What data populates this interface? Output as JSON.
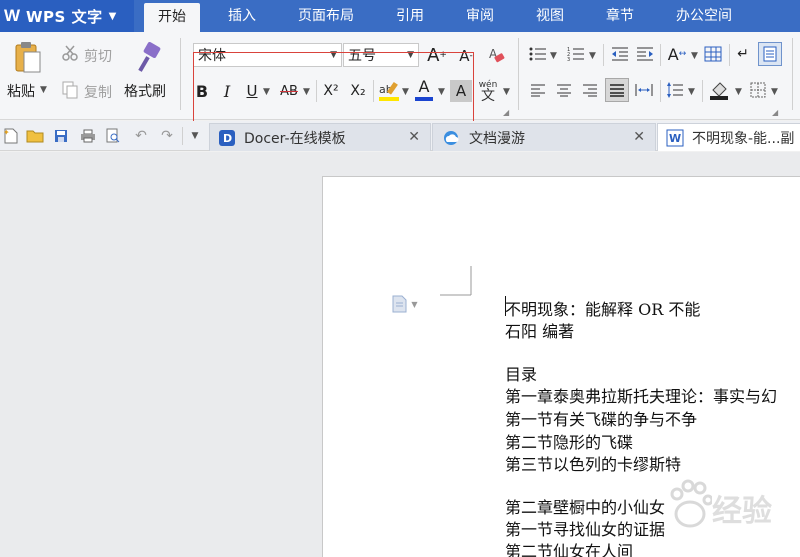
{
  "app": {
    "title": "WPS 文字",
    "logo": "W"
  },
  "menu": [
    "开始",
    "插入",
    "页面布局",
    "引用",
    "审阅",
    "视图",
    "章节",
    "办公空间"
  ],
  "ribbon": {
    "paste_label": "粘贴",
    "cut_label": "剪切",
    "copy_label": "复制",
    "format_painter_label": "格式刷",
    "font_name": "宋体",
    "font_size": "五号",
    "bold": "B",
    "italic": "I",
    "underline": "U",
    "strikethrough": "AB",
    "superscript": "X²",
    "subscript": "X₂",
    "font_color_glyph": "A",
    "char_shading_glyph": "A",
    "phonetic_glyph": "wén",
    "phonetic_char": "文",
    "grow_font": "A",
    "shrink_font": "A"
  },
  "tabs": [
    {
      "label": "Docer-在线模板",
      "icon": "docer-icon"
    },
    {
      "label": "文档漫游",
      "icon": "cloud-icon"
    },
    {
      "label": "不明现象-能...副",
      "icon": "word-doc-icon"
    }
  ],
  "document": {
    "lines": [
      "不明现象：能解释 OR 不能",
      "石阳 编著",
      "",
      "目录",
      "第一章泰奥弗拉斯托夫理论：事实与幻",
      "第一节有关飞碟的争与不争",
      "第二节隐形的飞碟",
      "第三节以色列的卡缪斯特",
      "",
      "第二章壁橱中的小仙女",
      "第一节寻找仙女的证据",
      "第二节仙女在人间"
    ]
  },
  "watermark": "经验"
}
